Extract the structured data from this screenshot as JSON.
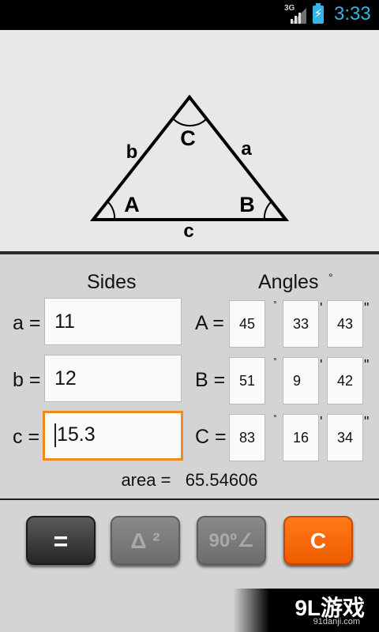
{
  "status_bar": {
    "network": "3G",
    "time": "3:33"
  },
  "diagram": {
    "vertex_labels": {
      "A": "A",
      "B": "B",
      "C": "C"
    },
    "side_labels": {
      "a": "a",
      "b": "b",
      "c": "c"
    }
  },
  "headers": {
    "sides": "Sides",
    "angles": "Angles",
    "angles_unit": "°"
  },
  "sides": [
    {
      "label": "a =",
      "value": "11"
    },
    {
      "label": "b =",
      "value": "12"
    },
    {
      "label": "c =",
      "value": "15.3",
      "focused": true
    }
  ],
  "angles": [
    {
      "label": "A =",
      "deg": "45",
      "min": "33",
      "sec": "43"
    },
    {
      "label": "B =",
      "deg": "51",
      "min": "9",
      "sec": "42"
    },
    {
      "label": "C =",
      "deg": "83",
      "min": "16",
      "sec": "34"
    }
  ],
  "angle_units": {
    "deg": "°",
    "min": "'",
    "sec": "\""
  },
  "area": {
    "label": "area =",
    "value": "65.54606"
  },
  "buttons": {
    "equals": "=",
    "square": "Δ ²",
    "right_angle": "90º∠",
    "clear": "C"
  },
  "colors": {
    "accent_orange": "#f08a1c",
    "status_blue": "#33b5e5",
    "clear_button": "#ef5b00"
  },
  "watermark": {
    "main": "9L游戏",
    "sub": "91danji.com"
  }
}
